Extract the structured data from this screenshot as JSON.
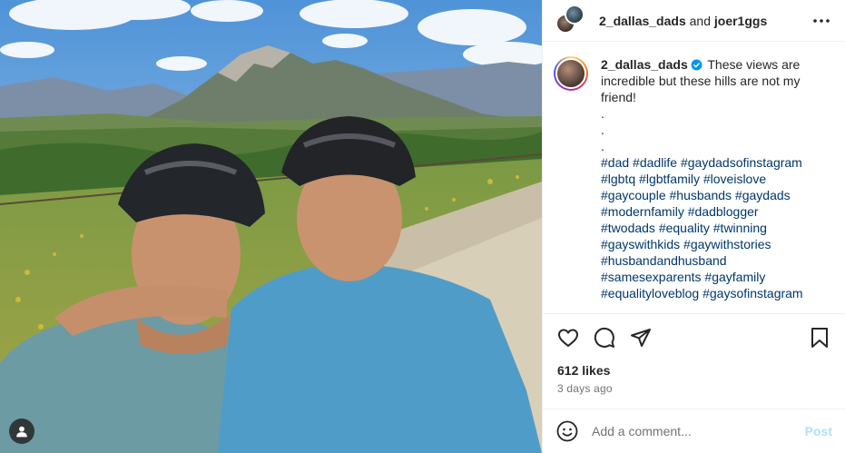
{
  "colors": {
    "accent": "#0095f6",
    "post_disabled": "#b2dffc",
    "hashtag": "#00376b",
    "muted": "#737373"
  },
  "header": {
    "user1": "2_dallas_dads",
    "conjunction": "and",
    "user2": "joer1ggs",
    "more_icon": "more-horizontal-icon"
  },
  "caption": {
    "username": "2_dallas_dads",
    "verified_icon": "verified-badge-icon",
    "text": "These views are incredible but these hills are not my friend!",
    "spacer_lines": [
      ".",
      ".",
      "."
    ],
    "hashtags": [
      [
        "#dad",
        "#dadlife",
        "#gaydadsofinstagram"
      ],
      [
        "#lgbtq",
        "#lgbtfamily",
        "#loveislove"
      ],
      [
        "#gaycouple",
        "#husbands",
        "#gaydads"
      ],
      [
        "#modernfamily",
        "#dadblogger"
      ],
      [
        "#twodads",
        "#equality",
        "#twinning"
      ],
      [
        "#gayswithkids",
        "#gaywithstories"
      ],
      [
        "#husbandandhusband"
      ],
      [
        "#samesexparents",
        "#gayfamily"
      ],
      [
        "#equalityloveblog",
        "#gaysofinstagram"
      ]
    ]
  },
  "actions": {
    "like_icon": "heart-icon",
    "comment_icon": "comment-icon",
    "share_icon": "send-icon",
    "save_icon": "bookmark-icon"
  },
  "stats": {
    "likes": "612 likes",
    "time_ago": "3 days ago"
  },
  "comment": {
    "emoji_icon": "emoji-icon",
    "placeholder": "Add a comment...",
    "post_label": "Post"
  },
  "photo": {
    "tag_icon": "user-tag-icon"
  }
}
